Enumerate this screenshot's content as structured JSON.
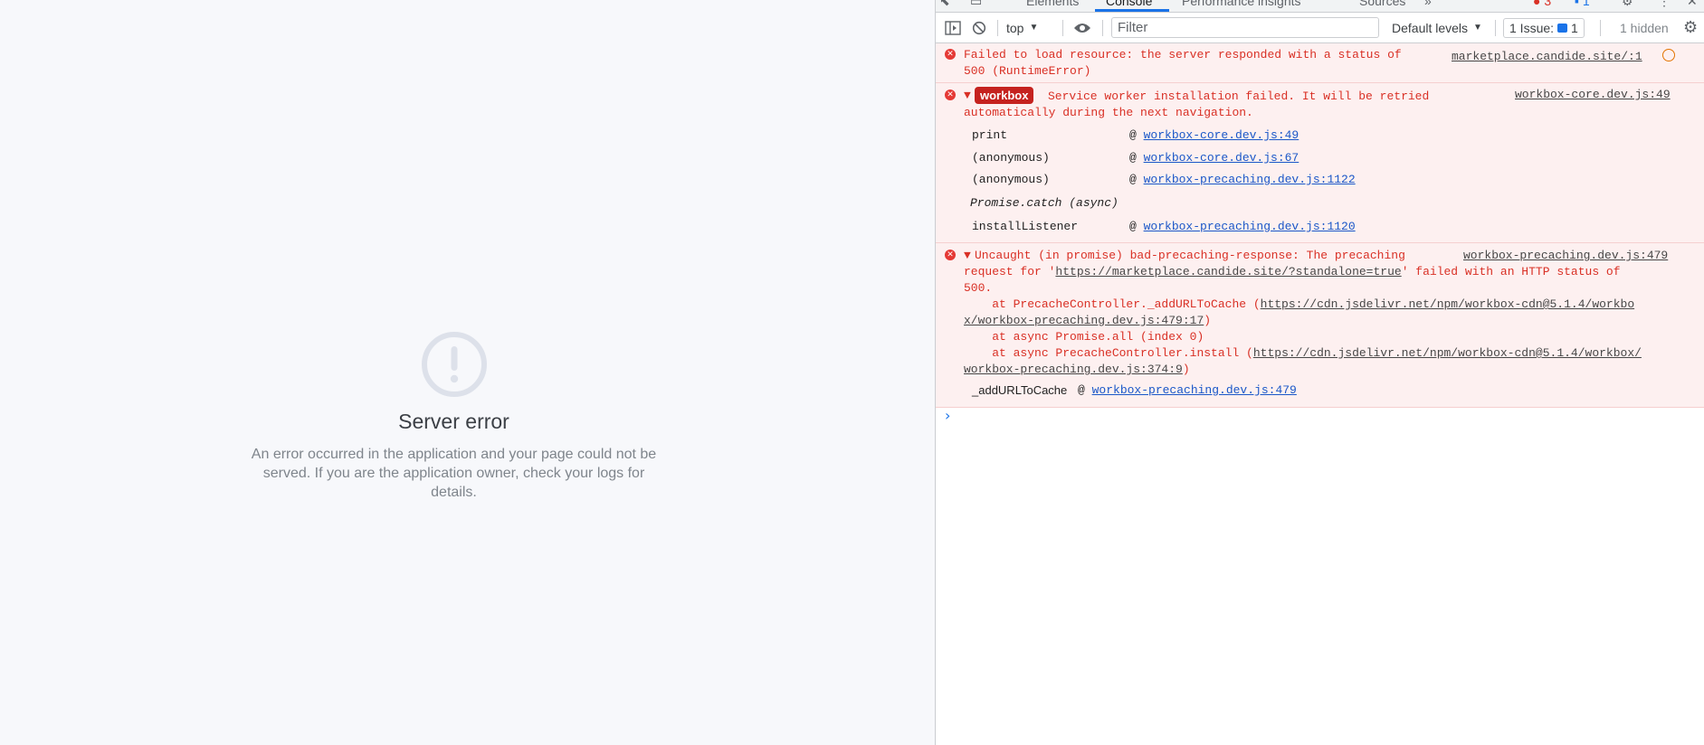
{
  "page": {
    "title": "Server error",
    "message": "An error occurred in the application and your page could not be served. If you are the application owner, check your logs for details."
  },
  "devtools": {
    "tabs": [
      "Elements",
      "Console",
      "Performance insights",
      "Sources",
      "»"
    ],
    "active_tab": "Console",
    "toolbar": {
      "context": "top",
      "filter_placeholder": "Filter",
      "levels": "Default levels",
      "issues_label": "1 Issue:",
      "issues_count": "1",
      "hidden": "1 hidden"
    },
    "messages": [
      {
        "line1": "Failed to load resource: the server responded with a status of",
        "line2": "500 (RuntimeError)",
        "source": "marketplace.candide.site/:1"
      },
      {
        "badge": "workbox",
        "line1": "Service worker installation failed. It will be retried",
        "line2": "automatically during the next navigation.",
        "source": "workbox-core.dev.js:49",
        "stack": [
          {
            "fn": "print",
            "link": "workbox-core.dev.js:49"
          },
          {
            "fn": "(anonymous)",
            "link": "workbox-core.dev.js:67"
          },
          {
            "fn": "(anonymous)",
            "link": "workbox-precaching.dev.js:1122"
          },
          {
            "fn": "Promise.catch (async)"
          },
          {
            "fn": "installListener",
            "link": "workbox-precaching.dev.js:1120"
          }
        ]
      },
      {
        "l1": "Uncaught (in promise) bad-precaching-response: The precaching",
        "l2_pre": "request for '",
        "l2_link": "https://marketplace.candide.site/?standalone=true",
        "l2_post": "' failed with an HTTP status of",
        "l3": "500.",
        "l4_pre": "    at PrecacheController._addURLToCache (",
        "l4_link": "https://cdn.jsdelivr.net/npm/workbox-cdn@5.1.4/workbo",
        "l5_link": "x/workbox-precaching.dev.js:479:17",
        "l5_post": ")",
        "l6": "    at async Promise.all (index 0)",
        "l7_pre": "    at async PrecacheController.install (",
        "l7_link": "https://cdn.jsdelivr.net/npm/workbox-cdn@5.1.4/workbox/",
        "l8_link": "workbox-precaching.dev.js:374:9",
        "l8_post": ")",
        "source": "workbox-precaching.dev.js:479",
        "stack_fn": "_addURLToCache",
        "stack_link": "workbox-precaching.dev.js:479"
      }
    ],
    "prompt": "›"
  }
}
